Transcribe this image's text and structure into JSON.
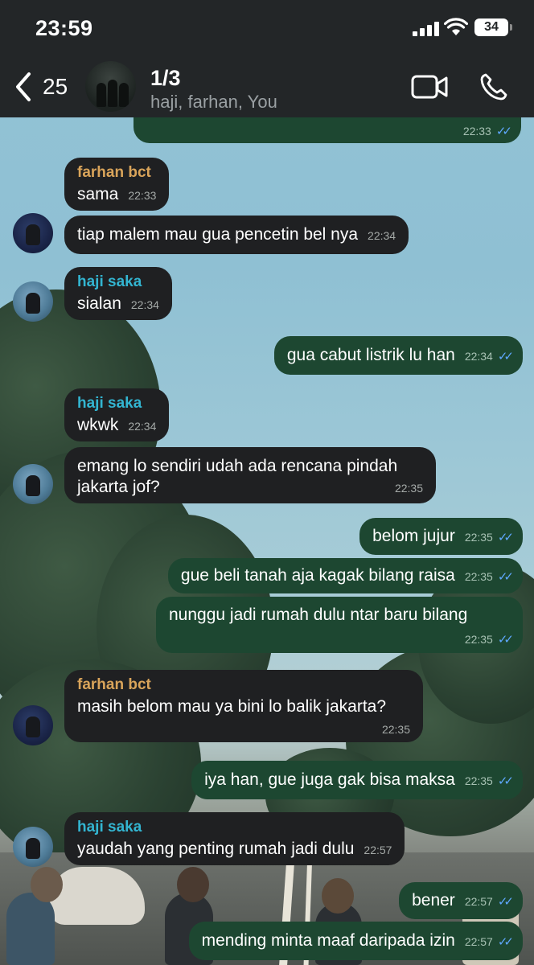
{
  "status_bar": {
    "time": "23:59",
    "battery": "34"
  },
  "header": {
    "back_count": "25",
    "title": "1/3",
    "subtitle": "haji, farhan, You"
  },
  "colors": {
    "incoming_bubble": "#1f2022",
    "outgoing_bubble": "#1d4731",
    "farhan_name": "#d9a45a",
    "haji_name": "#33b5d1",
    "read_ticks": "#5fa8ff"
  },
  "messages": [
    {
      "direction": "out",
      "text": "",
      "time": "22:33",
      "read": true
    },
    {
      "direction": "in",
      "sender": "farhan bct",
      "text": "sama",
      "time": "22:33"
    },
    {
      "direction": "in",
      "sender": "",
      "text": "tiap malem mau gua pencetin bel nya",
      "time": "22:34"
    },
    {
      "direction": "in",
      "sender": "haji saka",
      "text": "sialan",
      "time": "22:34"
    },
    {
      "direction": "out",
      "text": "gua cabut listrik lu han",
      "time": "22:34",
      "read": true
    },
    {
      "direction": "in",
      "sender": "haji saka",
      "text": "wkwk",
      "time": "22:34"
    },
    {
      "direction": "in",
      "sender": "",
      "text_line1": "emang lo sendiri udah ada rencana pindah",
      "text_line2": "jakarta jof?",
      "time": "22:35"
    },
    {
      "direction": "out",
      "text": "belom jujur",
      "time": "22:35",
      "read": true
    },
    {
      "direction": "out",
      "text": "gue beli tanah aja kagak bilang raisa",
      "time": "22:35",
      "read": true
    },
    {
      "direction": "out",
      "text": "nunggu jadi rumah dulu ntar baru bilang",
      "time": "22:35",
      "read": true
    },
    {
      "direction": "in",
      "sender": "farhan bct",
      "text": "masih belom mau ya bini lo balik jakarta?",
      "time": "22:35"
    },
    {
      "direction": "out",
      "text": "iya han, gue juga gak bisa maksa",
      "time": "22:35",
      "read": true
    },
    {
      "direction": "in",
      "sender": "haji saka",
      "text": "yaudah yang penting rumah jadi dulu",
      "time": "22:57"
    },
    {
      "direction": "out",
      "text": "bener",
      "time": "22:57",
      "read": true
    },
    {
      "direction": "out",
      "text": "mending minta maaf daripada izin",
      "time": "22:57",
      "read": true
    }
  ]
}
